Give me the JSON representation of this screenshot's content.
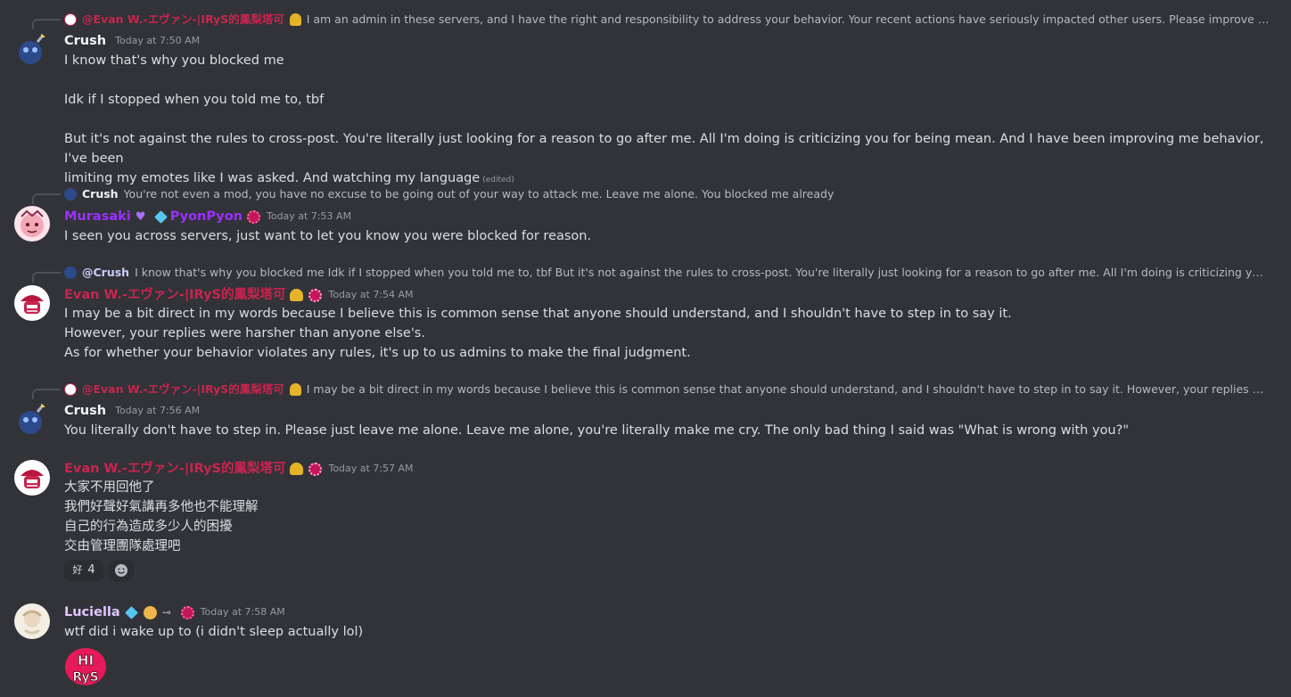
{
  "messages": [
    {
      "reply": {
        "name": "@Evan W.-エヴァン-|IRyS的鳳梨塔可",
        "text": "I am an admin in these servers, and I have the right and responsibility to address your behavior.   Your recent actions have seriously impacted other users. Please improve your behavior..."
      },
      "author": "Crush",
      "timestamp": "Today at 7:50 AM",
      "lines": [
        "I know that's why you blocked me",
        "",
        "Idk if I stopped when you told me to, tbf",
        "",
        "But it's not against the rules to cross-post. You're literally just looking for a reason to go after me. All I'm doing is criticizing you for being mean. And I have been improving me behavior, I've been",
        "limiting my emotes like I was asked. And watching my language"
      ],
      "edited": "(edited)"
    },
    {
      "reply": {
        "name": "Crush",
        "text": "You're not even a mod, you have no excuse to be going out of your way to attack me. Leave me alone. You blocked me already"
      },
      "author": "Murasaki",
      "author2": "PyonPyon",
      "timestamp": "Today at 7:53 AM",
      "lines": [
        "I seen you across servers, just want to let you know you were blocked for reason."
      ]
    },
    {
      "reply": {
        "name": "@Crush",
        "text": "I know that's why you blocked me  Idk if I stopped when you told me to, tbf  But it's not against the rules to cross-post. You're literally just looking for a reason to go after me. All I'm doing is criticizing you for being me..."
      },
      "author": "Evan W.-エヴァン-|IRyS的鳳梨塔可",
      "timestamp": "Today at 7:54 AM",
      "lines": [
        "I may be a bit direct in my words because I believe this is common sense that anyone should understand, and I shouldn't have to step in to say it.",
        "However, your replies were harsher than anyone else's.",
        "As for whether your behavior violates any rules, it's up to us admins to make the final judgment."
      ]
    },
    {
      "reply": {
        "name": "@Evan W.-エヴァン-|IRyS的鳳梨塔可",
        "text": "I may be a bit direct in my words because I believe this is common sense that anyone should understand, and I shouldn't have to step in to say it.   However, your replies were harsher ..."
      },
      "author": "Crush",
      "timestamp": "Today at 7:56 AM",
      "lines": [
        "You literally don't have to step in. Please just leave me alone. Leave me alone, you're literally make me cry. The only bad thing I said was \"What is wrong with you?\""
      ]
    },
    {
      "author": "Evan W.-エヴァン-|IRyS的鳳梨塔可",
      "timestamp": "Today at 7:57 AM",
      "lines": [
        "大家不用回他了",
        "我們好聲好氣講再多他也不能理解",
        "自己的行為造成多少人的困擾",
        "交由管理團隊處理吧"
      ],
      "reactions": [
        {
          "emoji": "好",
          "count": "4"
        }
      ]
    },
    {
      "author": "Luciella",
      "timestamp": "Today at 7:58 AM",
      "lines": [
        "wtf did i wake up to (i didn't sleep actually lol)"
      ],
      "sticker": "HI RyS"
    }
  ],
  "colors": {
    "crush": "#f2f3f5",
    "murasaki": "#9b30ff",
    "evan": "#c8254e",
    "luciella": "#e0c6ff",
    "timestamp": "#949ba4"
  }
}
